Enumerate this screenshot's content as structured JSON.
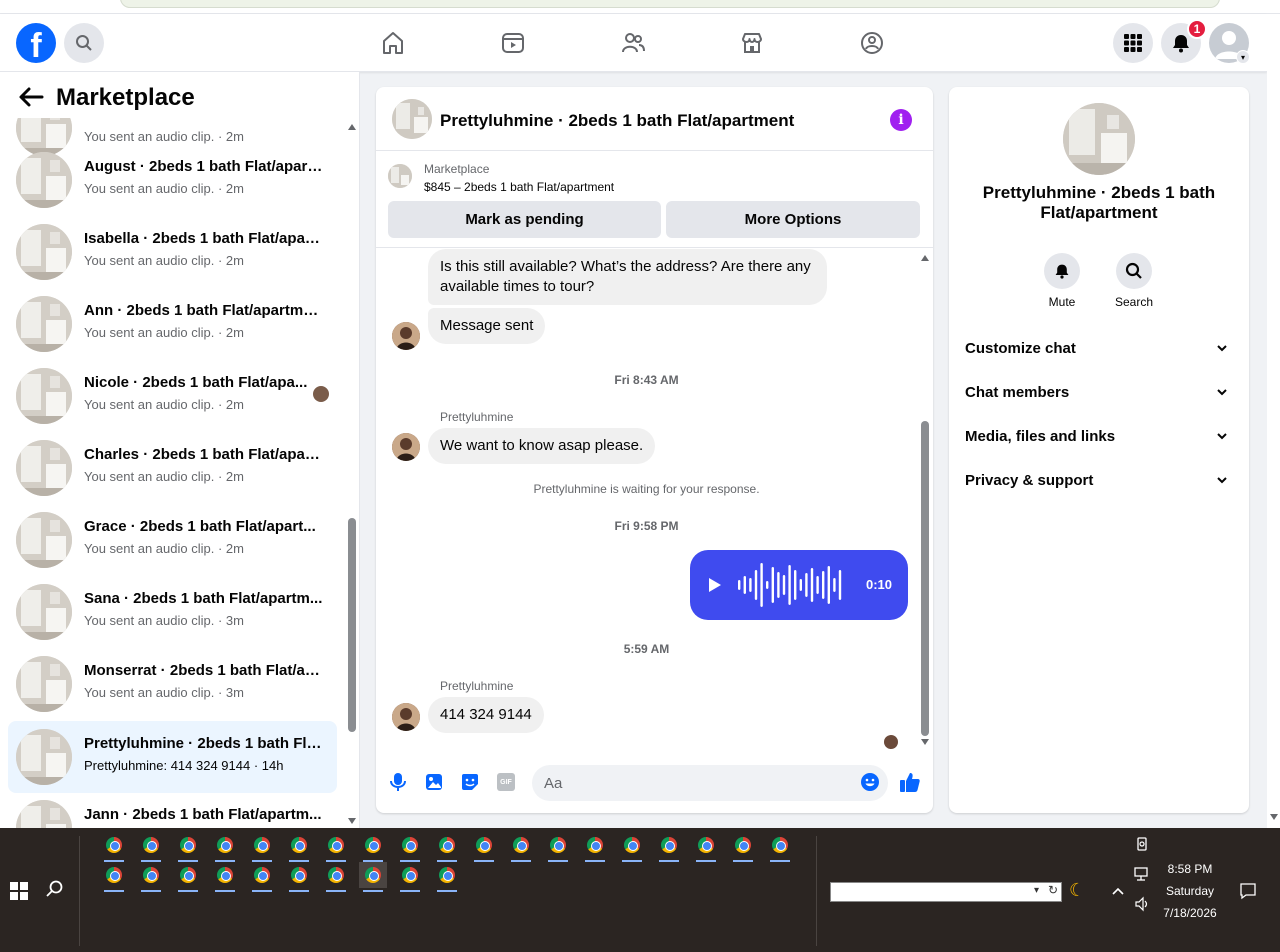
{
  "nav": {
    "logo": "f",
    "notifications_count": "1",
    "icons": [
      "home-icon",
      "video-icon",
      "friends-icon",
      "marketplace-icon",
      "groups-icon"
    ]
  },
  "sidebar": {
    "title": "Marketplace",
    "conversations": [
      {
        "title": "",
        "subtitle": "You sent an audio clip. · 2m"
      },
      {
        "title": "August · 2beds 1 bath Flat/apart...",
        "subtitle": "You sent an audio clip. · 2m"
      },
      {
        "title": "Isabella · 2beds 1 bath Flat/apart...",
        "subtitle": "You sent an audio clip. · 2m"
      },
      {
        "title": "Ann · 2beds 1 bath Flat/apartment",
        "subtitle": "You sent an audio clip. · 2m"
      },
      {
        "title": "Nicole · 2beds 1 bath Flat/apa...",
        "subtitle": "You sent an audio clip. · 2m"
      },
      {
        "title": "Charles · 2beds 1 bath Flat/apart...",
        "subtitle": "You sent an audio clip. · 2m"
      },
      {
        "title": "Grace · 2beds 1 bath Flat/apart...",
        "subtitle": "You sent an audio clip. · 2m"
      },
      {
        "title": "Sana · 2beds 1 bath Flat/apartm...",
        "subtitle": "You sent an audio clip. · 3m"
      },
      {
        "title": "Monserrat · 2beds 1 bath Flat/ap...",
        "subtitle": "You sent an audio clip. · 3m"
      },
      {
        "title": "Prettyluhmine · 2beds 1 bath Fla...",
        "subtitle": "Prettyluhmine: 414 324 9144 · 14h"
      },
      {
        "title": "Jann · 2beds 1 bath Flat/apartm...",
        "subtitle": ""
      }
    ]
  },
  "chat": {
    "title": "Prettyluhmine · 2beds 1 bath Flat/apartment",
    "listing_label": "Marketplace",
    "listing_price": "$845 – 2beds 1 bath Flat/apartment",
    "mark_pending": "Mark as pending",
    "more_options": "More Options",
    "msg1": "Is this still available? What’s the address? Are there any available times to tour?",
    "msg2": "Message sent",
    "ts1": "Fri 8:43 AM",
    "sender": "Prettyluhmine",
    "msg3": "We want to know asap please.",
    "waiting": "Prettyluhmine is waiting for your response.",
    "ts2": "Fri 9:58 PM",
    "audio_duration": "0:10",
    "ts3": "5:59 AM",
    "msg4": "414 324 9144",
    "input_placeholder": "Aa",
    "gif_label": "GIF"
  },
  "rpanel": {
    "title": "Prettyluhmine · 2beds 1 bath Flat/apartment",
    "mute": "Mute",
    "search": "Search",
    "rows": [
      "Customize chat",
      "Chat members",
      "Media, files and links",
      "Privacy & support"
    ]
  },
  "taskbar": {
    "time": "8:58 PM",
    "day": "Saturday",
    "date": "7/18/2026"
  },
  "colors": {
    "brand": "#0866ff",
    "audio_bubble": "#3f4bef",
    "active_row": "#ebf5ff",
    "badge": "#e41e3f",
    "info": "#a020f0"
  }
}
